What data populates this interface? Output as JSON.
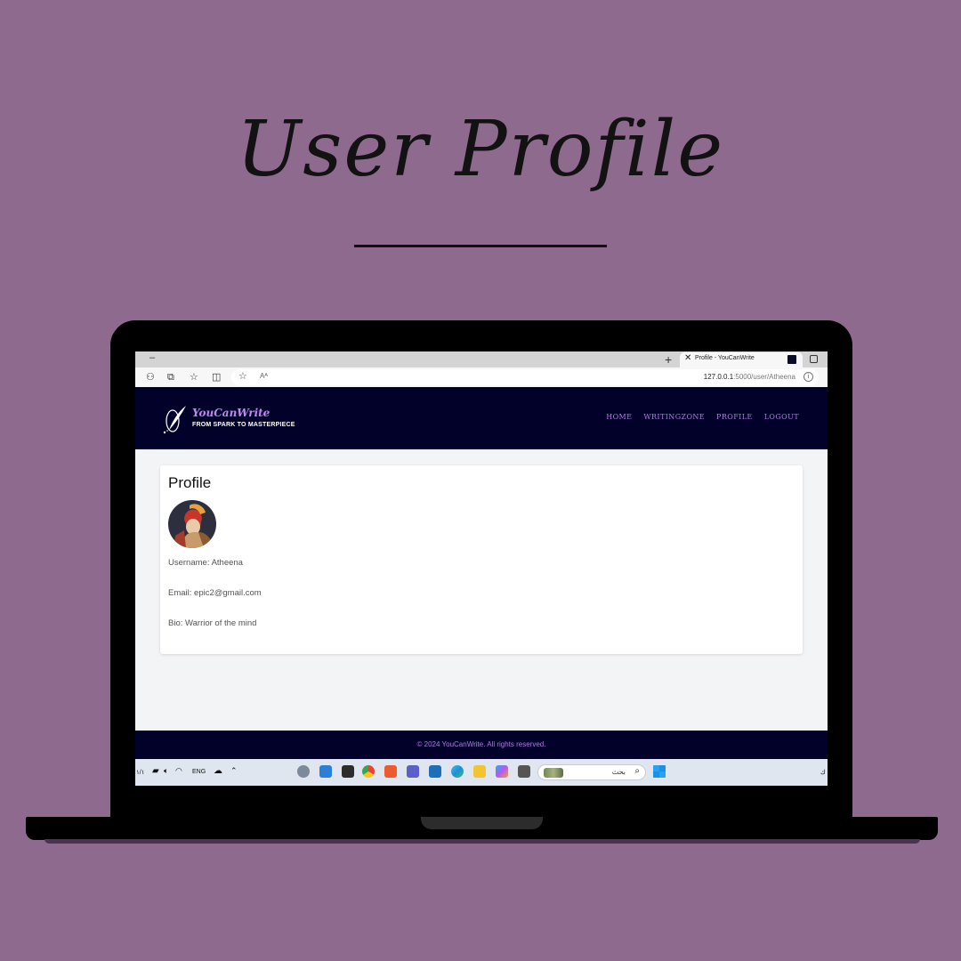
{
  "headline": "User Profile",
  "browser": {
    "tab_title": "Profile - YouCanWrite",
    "tab_close_icon": "close-icon",
    "new_tab_icon": "plus-icon",
    "url_host": "127.0.0.1",
    "url_path": ":5000/user/Atheena",
    "reader_label": "Aᴬ"
  },
  "site": {
    "brand_name": "YouCanWrite",
    "tagline": "FROM SPARK TO MASTERPIECE",
    "nav": {
      "home": "HOME",
      "writingzone": "WRITINGZONE",
      "profile": "PROFILE",
      "logout": "LOGOUT"
    },
    "colors": {
      "header_bg": "#01012a",
      "accent": "#b07ce0",
      "page_bg": "#f3f4f6"
    }
  },
  "profile": {
    "heading": "Profile",
    "username_line": "Username: Atheena",
    "email_line": "Email: epic2@gmail.com",
    "bio_line": "Bio: Warrior of the mind"
  },
  "footer": {
    "text": "© 2024 YouCanWrite. All rights reserved."
  },
  "taskbar": {
    "language": "ENG",
    "date_fragment": "١/١",
    "search_placeholder": "بحث",
    "end_fragment": "ك"
  }
}
